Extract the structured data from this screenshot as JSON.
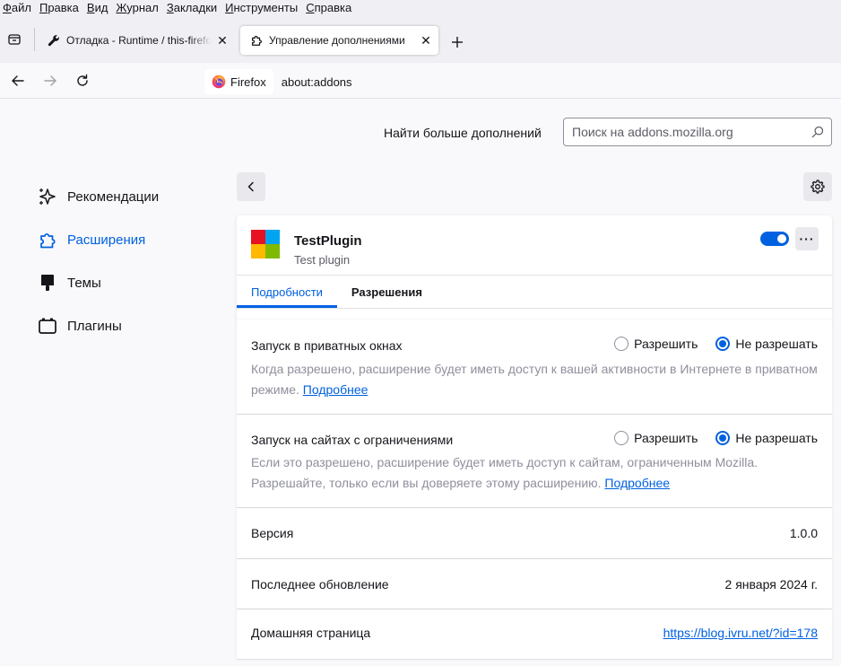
{
  "menu": {
    "items": [
      {
        "label": "Файл"
      },
      {
        "label": "Правка"
      },
      {
        "label": "Вид"
      },
      {
        "label": "Журнал"
      },
      {
        "label": "Закладки"
      },
      {
        "label": "Инструменты"
      },
      {
        "label": "Справка"
      }
    ]
  },
  "tabs": [
    {
      "title": "Отладка - Runtime / this-firefox",
      "icon": "wrench-icon"
    },
    {
      "title": "Управление дополнениями",
      "icon": "puzzle-icon",
      "active": true
    }
  ],
  "urlbar": {
    "identity": "Firefox",
    "url": "about:addons"
  },
  "header": {
    "find_more": "Найти больше дополнений",
    "search_placeholder": "Поиск на addons.mozilla.org"
  },
  "sidebar": {
    "items": [
      {
        "label": "Рекомендации",
        "icon": "sparkles-icon"
      },
      {
        "label": "Расширения",
        "icon": "puzzle-icon",
        "selected": true
      },
      {
        "label": "Темы",
        "icon": "brush-icon"
      },
      {
        "label": "Плагины",
        "icon": "plugin-icon"
      }
    ]
  },
  "addon": {
    "name": "TestPlugin",
    "description": "Test plugin",
    "enabled": true,
    "icon_colors": [
      "#e81123",
      "#00a4ef",
      "#ffb900",
      "#7fba00"
    ],
    "tabs": [
      {
        "label": "Подробности",
        "active": true
      },
      {
        "label": "Разрешения"
      }
    ]
  },
  "sections": {
    "private": {
      "title": "Запуск в приватных окнах",
      "allow": "Разрешить",
      "deny": "Не разрешать",
      "selected": "deny",
      "desc": "Когда разрешено, расширение будет иметь доступ к вашей активности в Интернете в приватном режиме.",
      "learn_more": "Подробнее"
    },
    "restricted": {
      "title": "Запуск на сайтах с ограничениями",
      "allow": "Разрешить",
      "deny": "Не разрешать",
      "selected": "deny",
      "desc": "Если это разрешено, расширение будет иметь доступ к сайтам, ограниченным Mozilla. Разрешайте, только если вы доверяете этому расширению.",
      "learn_more": "Подробнее"
    }
  },
  "details": {
    "version_label": "Версия",
    "version_value": "1.0.0",
    "updated_label": "Последнее обновление",
    "updated_value": "2 января 2024 г.",
    "homepage_label": "Домашняя страница",
    "homepage_value": "https://blog.ivru.net/?id=178"
  },
  "colors": {
    "accent": "#0061e0",
    "chrome": "#f0f0f4",
    "background": "#f9f9fb"
  }
}
